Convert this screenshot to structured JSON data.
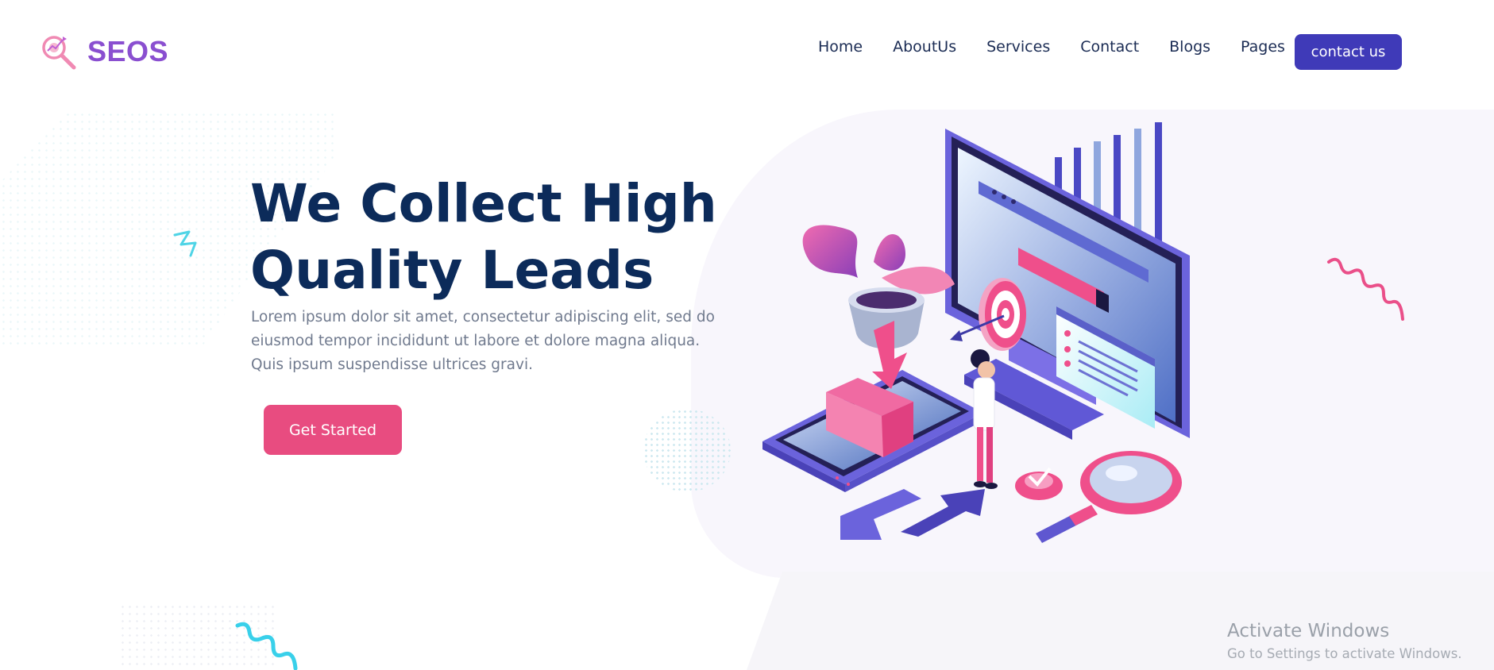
{
  "brand": {
    "name": "SEOS"
  },
  "nav": {
    "items": [
      "Home",
      "AboutUs",
      "Services",
      "Contact",
      "Blogs",
      "Pages"
    ],
    "cta_label": "contact us"
  },
  "hero": {
    "title_line1": "We Collect High",
    "title_line2": "Quality Leads",
    "description": "Lorem ipsum dolor sit amet, consectetur adipiscing elit, sed do eiusmod tempor incididunt ut labore et dolore magna aliqua. Quis ipsum suspendisse ultrices gravi.",
    "button_label": "Get Started"
  },
  "watermark": {
    "title": "Activate Windows",
    "subtitle": "Go to Settings to activate Windows."
  },
  "colors": {
    "primary": "#3f3ab8",
    "accent": "#e84c80",
    "heading": "#0c2b5a",
    "logo": "#8a4fd0"
  },
  "icons": [
    "seo-magnifier-logo-icon",
    "monitor-illustration",
    "target-icon",
    "magnifying-glass-icon",
    "plant-icon",
    "squiggle-icon"
  ]
}
